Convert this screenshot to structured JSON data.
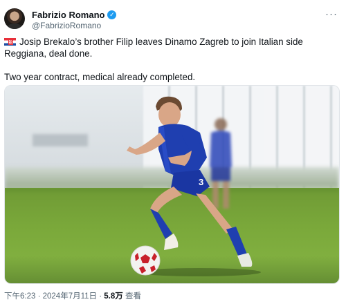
{
  "author": {
    "name": "Fabrizio Romano",
    "handle": "@FabrizioRomano",
    "verified_icon": "verified-badge-icon",
    "avatar_icon": "avatar"
  },
  "more_label": "···",
  "tweet": {
    "paragraph1": "Josip Brekalo’s brother Filip leaves Dinamo Zagreb to join Italian side Reggiana, deal done.",
    "paragraph2": "Two year contract, medical already completed.",
    "flag_icon": "croatia-flag-icon"
  },
  "media": {
    "shirt_number": "3"
  },
  "meta": {
    "time": "下午6:23",
    "separator": " · ",
    "date": "2024年7月11日",
    "views_count": "5.8万",
    "views_label": " 查看"
  },
  "colors": {
    "accent": "#1d9bf0",
    "text": "#0f1419",
    "muted": "#536471",
    "kit_blue": "#1f3fb0"
  }
}
